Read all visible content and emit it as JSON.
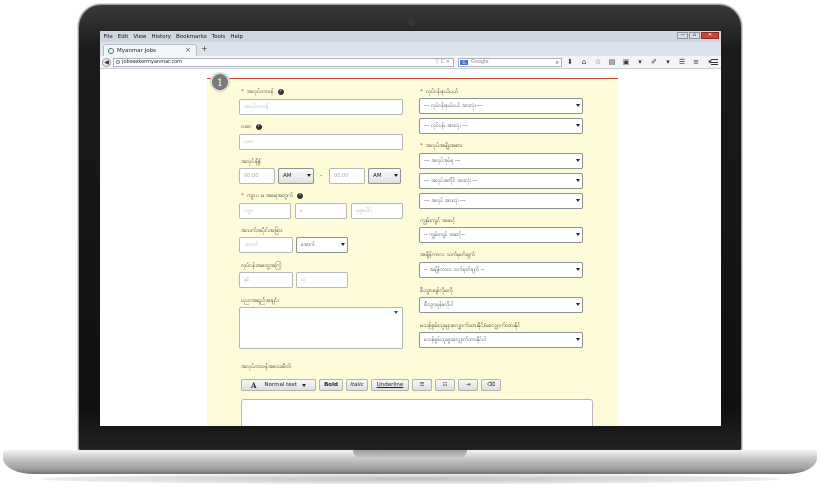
{
  "browser": {
    "menu": [
      "File",
      "Edit",
      "View",
      "History",
      "Bookmarks",
      "Tools",
      "Help"
    ],
    "window_controls": {
      "minimize": "—",
      "maximize": "▫",
      "close": "✕"
    },
    "tab_title": "Myanmar Jobs",
    "tab_close": "×",
    "new_tab": "+",
    "back": "◀",
    "url": "jobseekermyanmar.com",
    "url_controls": "▽ C ✕",
    "search_engine": "G",
    "search_placeholder": "Google",
    "search_icon": "⌕",
    "nav_icons": [
      "⬇",
      "⌂",
      "☆",
      "▤",
      "▣",
      "▾",
      "✐",
      "▾",
      "☰",
      "≡",
      "▾"
    ]
  },
  "form": {
    "step_number": "1",
    "left": {
      "job_title": {
        "label": "အလုပ်တာဝန်",
        "placeholder": "အလုပ်တာဝန်",
        "help": "?"
      },
      "salary": {
        "label": "လစာ",
        "placeholder": "လစာ",
        "help": "?"
      },
      "working_hours": {
        "label": "အလုပ်ချိန်",
        "from": "00:00",
        "from_ampm": "AM",
        "separator": "-",
        "to": "00:00",
        "to_ampm": "AM"
      },
      "age_range": {
        "label": "ကျား ၊ မ အရေအတွက်",
        "help": "?",
        "male": "ကျား",
        "female": "မ",
        "total": "စုစုပေါင်း"
      },
      "age": {
        "label": "အသက်အပိုင်းအခြား",
        "placeholder": "အသက်",
        "select": "အောက်"
      },
      "experience": {
        "label": "လုပ်ငန်းအတွေ့အကြုံ",
        "years": "နှစ်",
        "months": "လ"
      },
      "description": {
        "label": "ပညာအရည်အချင်း"
      },
      "job_requirements": {
        "label": "အလုပ်တာဝန်အသေးစိတ်"
      }
    },
    "right": {
      "industry": {
        "label": "လုပ်ငန်းနယ်ပယ်",
        "select1": "--- လုပ်ငန်းနယ်ပယ် အားလုံး ---",
        "select2": "--- လုပ်ငန်း အားလုံး ---"
      },
      "job_category": {
        "label": "အလုပ်အမျိုးအစား",
        "select1": "--- အလုပ်အုပ်စု ---",
        "select2": "--- အလုပ်အကိုင် အားလုံး ---",
        "select3": "--- အလုပ် အားလုံး ---"
      },
      "job_type": {
        "label": "ကျွမ်းကျင် အဆင့်",
        "select": "-- ကျွမ်းကျင် အဆင့်--"
      },
      "deadline": {
        "label": "အချိန်ကာလ သက်မှတ်ချက်",
        "select": "-- အချိန်ကာလ သက်မှတ်ချက် --"
      },
      "township": {
        "label": "စီးသွားရန်လိုမလို",
        "select": "စီးသွားရန်မလိုပါ"
      },
      "nationality": {
        "label": "မသန်စွမ်းသူများလျှောက်ထားနိုင်/မလျှောက်ထားနိုင်",
        "select": "မသန်စွမ်းသူများလျှောက်ထားနိုင်ပါ"
      }
    },
    "editor_toolbar": {
      "font_icon": "A",
      "style": "Normal text",
      "bold": "Bold",
      "italic": "Italic",
      "underline": "Underline",
      "bullets": "☰",
      "numbers": "☷",
      "indent": "⇥",
      "clear": "⌫"
    }
  }
}
